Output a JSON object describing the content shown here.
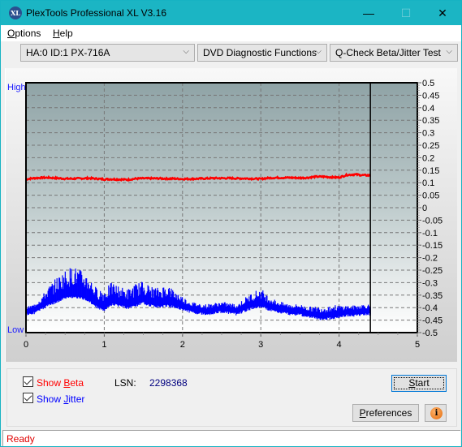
{
  "window": {
    "title": "PlexTools Professional XL V3.16",
    "app_icon_text": "XL",
    "minimize_glyph": "—",
    "maximize_glyph": "☐",
    "close_glyph": "✕"
  },
  "menu": {
    "items": [
      {
        "label": "Options",
        "accel": "O",
        "rest": "ptions"
      },
      {
        "label": "Help",
        "accel": "H",
        "rest": "elp"
      }
    ]
  },
  "toolbar": {
    "drive_select": "HA:0 ID:1  PX-716A",
    "function_select": "DVD Diagnostic Functions",
    "test_select": "Q-Check Beta/Jitter Test",
    "chevron": "⌵"
  },
  "chart_labels": {
    "high": "High",
    "low": "Low"
  },
  "chart_data": {
    "type": "line",
    "title": "",
    "xlabel": "",
    "ylabel": "",
    "xlim": [
      0,
      5
    ],
    "ylim": [
      -0.5,
      0.5
    ],
    "x_ticks": [
      "0",
      "1",
      "2",
      "3",
      "4",
      "5"
    ],
    "y_ticks": [
      "0.5",
      "0.45",
      "0.4",
      "0.35",
      "0.3",
      "0.25",
      "0.2",
      "0.15",
      "0.1",
      "0.05",
      "0",
      "-0.05",
      "-0.1",
      "-0.15",
      "-0.2",
      "-0.25",
      "-0.3",
      "-0.35",
      "-0.4",
      "-0.45",
      "-0.5"
    ],
    "grid": true,
    "position_marker_x": 4.4,
    "series": [
      {
        "name": "Beta",
        "color": "#ff0000",
        "x": [
          0,
          0.1,
          0.2,
          0.3,
          0.4,
          0.5,
          0.6,
          0.7,
          0.8,
          0.9,
          1.0,
          1.1,
          1.2,
          1.3,
          1.4,
          1.5,
          1.6,
          1.7,
          1.8,
          1.9,
          2.0,
          2.1,
          2.2,
          2.3,
          2.4,
          2.5,
          2.6,
          2.7,
          2.8,
          2.9,
          3.0,
          3.1,
          3.2,
          3.3,
          3.4,
          3.5,
          3.6,
          3.7,
          3.8,
          3.9,
          4.0,
          4.1,
          4.2,
          4.3,
          4.4
        ],
        "y": [
          0.114,
          0.118,
          0.12,
          0.12,
          0.118,
          0.116,
          0.116,
          0.117,
          0.118,
          0.116,
          0.114,
          0.114,
          0.113,
          0.112,
          0.116,
          0.117,
          0.117,
          0.117,
          0.116,
          0.116,
          0.115,
          0.115,
          0.116,
          0.117,
          0.118,
          0.118,
          0.118,
          0.117,
          0.117,
          0.116,
          0.115,
          0.119,
          0.12,
          0.12,
          0.12,
          0.119,
          0.12,
          0.124,
          0.124,
          0.122,
          0.121,
          0.131,
          0.133,
          0.13,
          0.129
        ]
      },
      {
        "name": "Jitter",
        "color": "#0000ff",
        "x": [
          0,
          0.1,
          0.2,
          0.3,
          0.4,
          0.5,
          0.6,
          0.7,
          0.8,
          0.9,
          1.0,
          1.1,
          1.2,
          1.3,
          1.4,
          1.5,
          1.6,
          1.7,
          1.8,
          1.9,
          2.0,
          2.1,
          2.2,
          2.3,
          2.4,
          2.5,
          2.6,
          2.7,
          2.8,
          2.9,
          3.0,
          3.1,
          3.2,
          3.3,
          3.4,
          3.5,
          3.6,
          3.7,
          3.8,
          3.9,
          4.0,
          4.1,
          4.2,
          4.3,
          4.4
        ],
        "y": [
          -0.41,
          -0.405,
          -0.39,
          -0.37,
          -0.36,
          -0.345,
          -0.34,
          -0.345,
          -0.355,
          -0.38,
          -0.395,
          -0.37,
          -0.375,
          -0.385,
          -0.375,
          -0.365,
          -0.375,
          -0.38,
          -0.375,
          -0.38,
          -0.39,
          -0.4,
          -0.405,
          -0.41,
          -0.405,
          -0.4,
          -0.405,
          -0.41,
          -0.395,
          -0.385,
          -0.38,
          -0.39,
          -0.4,
          -0.405,
          -0.41,
          -0.41,
          -0.42,
          -0.425,
          -0.43,
          -0.425,
          -0.42,
          -0.415,
          -0.415,
          -0.41,
          -0.41
        ],
        "spread": [
          0.01,
          0.015,
          0.03,
          0.05,
          0.07,
          0.08,
          0.09,
          0.08,
          0.07,
          0.05,
          0.06,
          0.06,
          0.05,
          0.05,
          0.06,
          0.06,
          0.05,
          0.05,
          0.06,
          0.04,
          0.03,
          0.02,
          0.02,
          0.02,
          0.02,
          0.02,
          0.02,
          0.02,
          0.03,
          0.04,
          0.05,
          0.03,
          0.025,
          0.02,
          0.02,
          0.02,
          0.02,
          0.025,
          0.03,
          0.03,
          0.025,
          0.02,
          0.02,
          0.02,
          0.02
        ]
      }
    ]
  },
  "controls": {
    "show_beta": {
      "prefix": "Show ",
      "accel": "B",
      "rest": "eta",
      "checked": true,
      "color": "#ff0000"
    },
    "show_jitter": {
      "prefix": "Show ",
      "accel": "J",
      "rest": "itter",
      "checked": true,
      "color": "#0000ff"
    },
    "lsn_label": "LSN:",
    "lsn_value": "2298368",
    "start_button": {
      "accel": "S",
      "rest": "tart"
    },
    "preferences_button": {
      "accel": "P",
      "rest": "references"
    },
    "info_button_glyph": "i"
  },
  "status": {
    "text": "Ready"
  }
}
